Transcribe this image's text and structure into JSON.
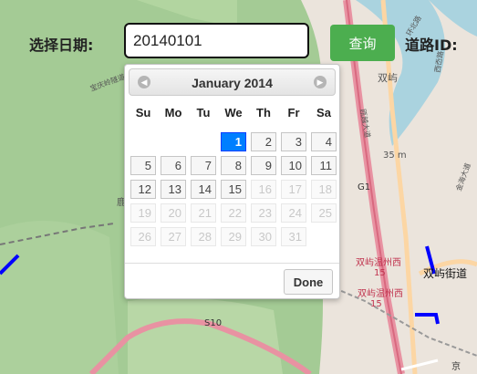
{
  "toolbar": {
    "date_label": "选择日期:",
    "date_value": "20140101",
    "query_label": "查询",
    "road_label": "道路ID:"
  },
  "datepicker": {
    "title": "January 2014",
    "prev_icon": "circle-triangle-left-icon",
    "next_icon": "circle-triangle-right-icon",
    "weekdays": [
      "Su",
      "Mo",
      "Tu",
      "We",
      "Th",
      "Fr",
      "Sa"
    ],
    "weeks": [
      [
        "",
        "",
        "",
        "1",
        "2",
        "3",
        "4"
      ],
      [
        "5",
        "6",
        "7",
        "8",
        "9",
        "10",
        "11"
      ],
      [
        "12",
        "13",
        "14",
        "15",
        "16",
        "17",
        "18"
      ],
      [
        "19",
        "20",
        "21",
        "22",
        "23",
        "24",
        "25"
      ],
      [
        "26",
        "27",
        "28",
        "29",
        "30",
        "31",
        ""
      ]
    ],
    "selected_day": "1",
    "last_enabled_day": 15,
    "done_label": "Done",
    "colors": {
      "selected_bg": "#007fff",
      "query_button": "#4cae4f"
    }
  },
  "map": {
    "labels": {
      "g1": "G1",
      "s10": "S10",
      "elevation": "35 m",
      "shuangyu": "双屿",
      "shuangyu_street": "双屿街道",
      "wenzhou_west_15a": "双屿温州西",
      "wenzhou_west_15b": "双屿温州西",
      "num_15a": "15",
      "num_15b": "15",
      "road_a": "瓯越大道",
      "road_b": "宝庆岭隧道",
      "road_c": "西岙路",
      "road_d": "金海大道",
      "road_e": "环北路",
      "jing": "京",
      "pin": "鹿"
    }
  }
}
